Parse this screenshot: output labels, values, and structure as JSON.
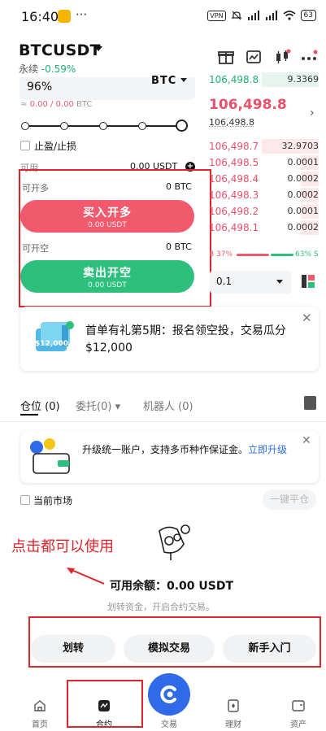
{
  "status_bar": {
    "time": "16:40",
    "dots": "···",
    "vpn": "VPN",
    "battery": "63"
  },
  "header": {
    "pair": "BTCUSDT",
    "type": "永续",
    "change": "-0.59%"
  },
  "trade_panel": {
    "percent_value": "96%",
    "coin": "BTC",
    "balance_left": "≈ ",
    "balance_red": "0.00 / 0.00",
    "balance_unit": " BTC",
    "tpsl_label": "止盈/止损",
    "available_label": "可用",
    "available_value": "0.00 USDT",
    "open_long_label": "可开多",
    "open_long_value": "0 BTC",
    "buy_button": "买入开多",
    "buy_sub": "0.00 USDT",
    "open_short_label": "可开空",
    "open_short_value": "0 BTC",
    "sell_button": "卖出开空",
    "sell_sub": "0.00 USDT"
  },
  "order_book": {
    "top_row": {
      "price": "106,498.8",
      "qty": "9.3369"
    },
    "mid_price": "106,498.8",
    "mark_price": "106,498.8",
    "asks": [
      {
        "price": "106,498.7",
        "qty": "32.9703"
      },
      {
        "price": "106,498.5",
        "qty": "0.0001"
      },
      {
        "price": "106,498.4",
        "qty": "0.0002"
      },
      {
        "price": "106,498.3",
        "qty": "0.0002"
      },
      {
        "price": "106,498.2",
        "qty": "0.0001"
      },
      {
        "price": "106,498.1",
        "qty": "0.0002"
      }
    ],
    "ratio_left": "B 37%",
    "ratio_right": "63% S",
    "depth": "0.1"
  },
  "promo": {
    "text": "首单有礼第5期：报名领空投，交易瓜分$12,000",
    "badge": "$12,000"
  },
  "tabs": [
    {
      "label": "仓位",
      "count": "(0)"
    },
    {
      "label": "委托",
      "count": "(0)"
    },
    {
      "label": "机器人",
      "count": "(0)"
    }
  ],
  "unify": {
    "text": "升级统一账户，支持多币种作保证金。",
    "link": "立即升级"
  },
  "market": {
    "current_market": "当前市场",
    "close_all": "一键平仓"
  },
  "annotation": "点击都可以使用",
  "empty_state": {
    "balance": "可用余额：0.00 USDT",
    "hint": "划转资金，开启合约交易。"
  },
  "actions": [
    "划转",
    "模拟交易",
    "新手入门"
  ],
  "nav": [
    {
      "label": "首页"
    },
    {
      "label": "合约"
    },
    {
      "label": "交易"
    },
    {
      "label": "理财"
    },
    {
      "label": "资产"
    }
  ]
}
